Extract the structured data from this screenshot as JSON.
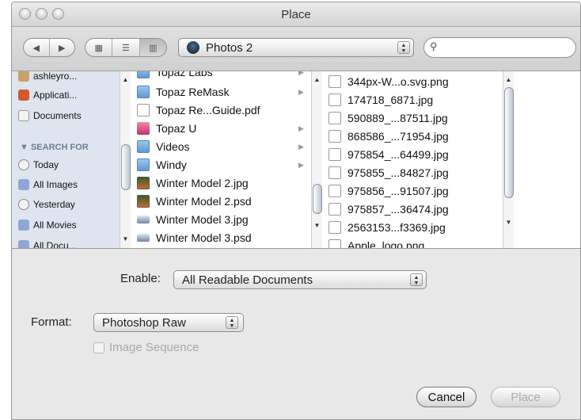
{
  "window": {
    "title": "Place"
  },
  "toolbar": {
    "nav_back_icon": "back-arrow-icon",
    "nav_forward_icon": "forward-arrow-icon",
    "view_modes": [
      "icon-view-icon",
      "list-view-icon",
      "column-view-icon"
    ],
    "location": "Photos 2",
    "search_placeholder": ""
  },
  "sidebar": {
    "items_top": [
      {
        "label": "ashleyro...",
        "icon": "home-icon"
      },
      {
        "label": "Applicati...",
        "icon": "applications-icon"
      },
      {
        "label": "Documents",
        "icon": "documents-icon"
      }
    ],
    "search_heading": "SEARCH FOR",
    "search_items": [
      {
        "label": "Today",
        "icon": "clock-icon"
      },
      {
        "label": "All Images",
        "icon": "smart-folder-icon"
      },
      {
        "label": "Yesterday",
        "icon": "clock-icon"
      },
      {
        "label": "All Movies",
        "icon": "smart-folder-icon"
      },
      {
        "label": "All Docu...",
        "icon": "smart-folder-icon"
      }
    ]
  },
  "column1": {
    "items": [
      {
        "label": "Topaz Labs",
        "kind": "folder",
        "has_children": true
      },
      {
        "label": "Topaz ReMask",
        "kind": "folder",
        "has_children": true
      },
      {
        "label": "Topaz Re...Guide.pdf",
        "kind": "doc",
        "has_children": false
      },
      {
        "label": "Topaz U",
        "kind": "app",
        "has_children": true
      },
      {
        "label": "Videos",
        "kind": "folder",
        "has_children": true
      },
      {
        "label": "Windy",
        "kind": "folder",
        "has_children": true
      },
      {
        "label": "Winter Model 2.jpg",
        "kind": "image",
        "has_children": false
      },
      {
        "label": "Winter Model 2.psd",
        "kind": "image",
        "has_children": false
      },
      {
        "label": "Winter Model 3.jpg",
        "kind": "image",
        "has_children": false
      },
      {
        "label": "Winter Model 3.psd",
        "kind": "image",
        "has_children": false
      }
    ]
  },
  "column2": {
    "items": [
      "344px-W...o.svg.png",
      "174718_6871.jpg",
      "590889_...87511.jpg",
      "868586_...71954.jpg",
      "975854_...64499.jpg",
      "975855_...84827.jpg",
      "975856_...91507.jpg",
      "975857_...36474.jpg",
      "2563153...f3369.jpg",
      "Apple_logo.png"
    ]
  },
  "options": {
    "enable_label": "Enable:",
    "enable_value": "All Readable Documents",
    "format_label": "Format:",
    "format_value": "Photoshop Raw",
    "image_sequence_label": "Image Sequence",
    "image_sequence_checked": false
  },
  "buttons": {
    "cancel": "Cancel",
    "place": "Place"
  }
}
